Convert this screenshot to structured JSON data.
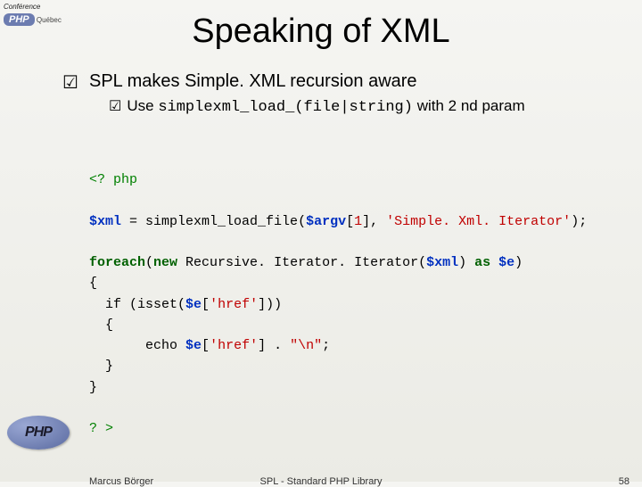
{
  "logo": {
    "conf_line": "Conférence",
    "brand": "PHP",
    "region": "Québec"
  },
  "title": "Speaking of XML",
  "bullet": {
    "main": "SPL makes Simple. XML recursion aware",
    "sub_prefix": "Use ",
    "sub_code": "simplexml_load_(file|string)",
    "sub_suffix": " with 2 nd param"
  },
  "code": {
    "open": "<? php",
    "l1_a": "$xml",
    "l1_b": " = ",
    "l1_c": "simplexml_load_file",
    "l1_d": "(",
    "l1_e": "$argv",
    "l1_f": "[",
    "l1_g": "1",
    "l1_h": "], ",
    "l1_i": "'Simple. Xml. Iterator'",
    "l1_j": ");",
    "l2_a": "foreach",
    "l2_b": "(",
    "l2_c": "new ",
    "l2_d": "Recursive. Iterator. Iterator",
    "l2_e": "(",
    "l2_f": "$xml",
    "l2_g": ") ",
    "l2_h": "as ",
    "l2_i": "$e",
    "l2_j": ")",
    "l3": "{",
    "l4_a": "  if (isset(",
    "l4_b": "$e",
    "l4_c": "[",
    "l4_d": "'href'",
    "l4_e": "]))",
    "l5": "  {",
    "l6_a": "       echo ",
    "l6_b": "$e",
    "l6_c": "[",
    "l6_d": "'href'",
    "l6_e": "] . ",
    "l6_f": "\"\\n\"",
    "l6_g": ";",
    "l7": "  }",
    "l8": "}",
    "close": "? >"
  },
  "footer": {
    "author": "Marcus Börger",
    "mid": "SPL - Standard PHP Library",
    "page": "58"
  }
}
